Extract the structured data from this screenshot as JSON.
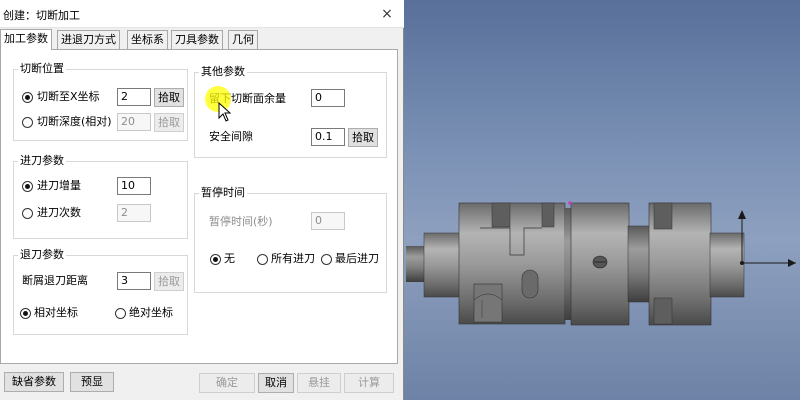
{
  "window": {
    "title": "创建：切断加工",
    "close_glyph": "×"
  },
  "tabs": [
    "加工参数",
    "进退刀方式",
    "坐标系",
    "刀具参数",
    "几何"
  ],
  "cut_position": {
    "title": "切断位置",
    "option_x": {
      "label": "切断至X坐标",
      "value": "2",
      "pick": "拾取",
      "selected": true
    },
    "option_depth": {
      "label": "切断深度(相对)",
      "value": "20",
      "pick": "拾取",
      "selected": false
    }
  },
  "feed_params": {
    "title": "进刀参数",
    "option_increment": {
      "label": "进刀增量",
      "value": "10",
      "selected": true
    },
    "option_count": {
      "label": "进刀次数",
      "value": "2",
      "selected": false
    }
  },
  "retract_params": {
    "title": "退刀参数",
    "distance": {
      "label": "断屑退刀距离",
      "value": "3",
      "pick": "拾取"
    },
    "relative": {
      "label": "相对坐标",
      "selected": true
    },
    "absolute": {
      "label": "绝对坐标",
      "selected": false
    }
  },
  "other_params": {
    "title": "其他参数",
    "allowance": {
      "label": "留下切断面余量",
      "value": "0"
    },
    "clearance": {
      "label": "安全间隙",
      "value": "0.1",
      "pick": "拾取"
    }
  },
  "dwell": {
    "title": "暂停时间",
    "time": {
      "label": "暂停时间(秒)",
      "value": "0"
    },
    "none": {
      "label": "无",
      "selected": true
    },
    "all": {
      "label": "所有进刀",
      "selected": false
    },
    "last": {
      "label": "最后进刀",
      "selected": false
    }
  },
  "footer": {
    "defaults": "缺省参数",
    "preview": "预显",
    "ok": "确定",
    "cancel": "取消",
    "suspend": "悬挂",
    "calculate": "计算"
  },
  "colors": {
    "viewport_bg": "#7b91b5",
    "part_grey": "#8a8a8a",
    "highlight": "#ffff00"
  }
}
